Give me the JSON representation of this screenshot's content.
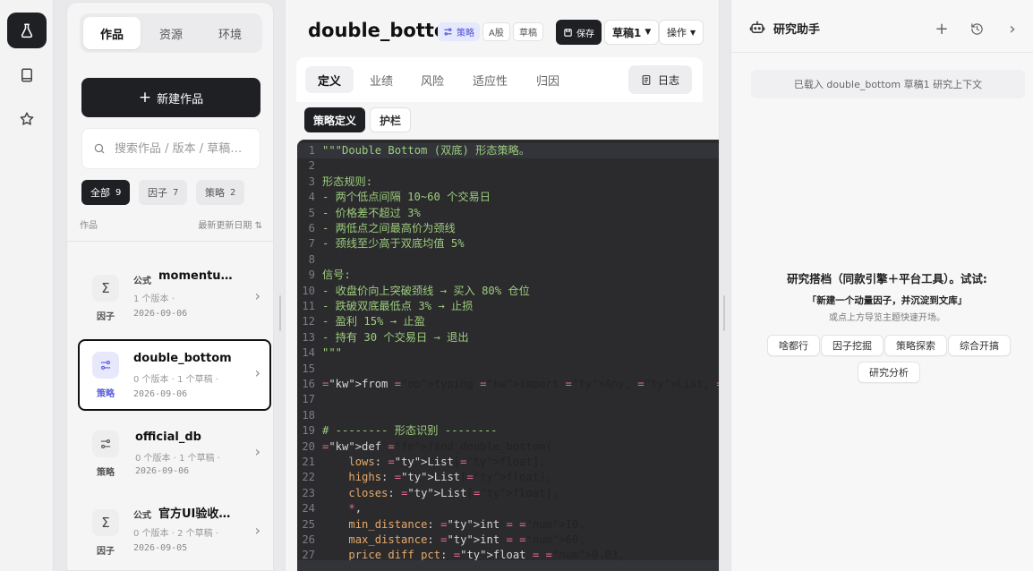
{
  "rail": {
    "items": [
      {
        "icon": "flask-icon",
        "active": true
      },
      {
        "icon": "book-icon",
        "active": false
      },
      {
        "icon": "star-icon",
        "active": false
      }
    ]
  },
  "works_panel": {
    "tabs": [
      "作品",
      "资源",
      "环境"
    ],
    "new_button": "新建作品",
    "search_placeholder": "搜索作品 / 版本 / 草稿…",
    "filters": [
      {
        "label": "全部",
        "count": "9"
      },
      {
        "label": "因子",
        "count": "7"
      },
      {
        "label": "策略",
        "count": "2"
      }
    ],
    "list_header": "作品",
    "sort_label": "最新更新日期",
    "items": [
      {
        "tag": "公式",
        "name": "momentu…",
        "meta": "1 个版本 ·",
        "date": "2026-09-06",
        "type": "因子",
        "kind": "factor"
      },
      {
        "tag": "",
        "name": "double_bottom",
        "meta": "0 个版本 · 1 个草稿 ·",
        "date": "2026-09-06",
        "type": "策略",
        "kind": "strategy"
      },
      {
        "tag": "",
        "name": "official_db",
        "meta": "0 个版本 · 1 个草稿 ·",
        "date": "2026-09-06",
        "type": "策略",
        "kind": "strategy"
      },
      {
        "tag": "公式",
        "name": "官方UI验收…",
        "meta": "0 个版本 · 2 个草稿 ·",
        "date": "2026-09-05",
        "type": "因子",
        "kind": "factor"
      }
    ]
  },
  "editor": {
    "title": "double_bottom",
    "badges": {
      "strategy": "策略",
      "market": "A股",
      "draft": "草稿"
    },
    "save_label": "保存",
    "draft_select": "草稿1",
    "ops_label": "操作",
    "tabs": [
      "定义",
      "业绩",
      "风险",
      "适应性",
      "归因"
    ],
    "log_label": "日志",
    "subtabs": [
      "策略定义",
      "护栏"
    ],
    "code_lines": [
      "\"\"\"Double Bottom (双底) 形态策略。",
      "",
      "形态规则:",
      "- 两个低点间隔 10~60 个交易日",
      "- 价格差不超过 3%",
      "- 两低点之间最高价为颈线",
      "- 颈线至少高于双底均值 5%",
      "",
      "信号:",
      "- 收盘价向上突破颈线 → 买入 80% 仓位",
      "- 跌破双底最低点 3% → 止损",
      "- 盈利 15% → 止盈",
      "- 持有 30 个交易日 → 退出",
      "\"\"\"",
      "",
      "from typing import Any, List, Optional, Tuple",
      "",
      "",
      "# -------- 形态识别 --------",
      "def find_double_bottom(",
      "    lows: List[float],",
      "    highs: List[float],",
      "    closes: List[float],",
      "    *,",
      "    min_distance: int = 10,",
      "    max_distance: int = 60,",
      "    price_diff_pct: float = 0.03,"
    ]
  },
  "assistant": {
    "title": "研究助手",
    "context": "已载入 double_bottom 草稿1 研究上下文",
    "headline": "研究搭档（同款引擎＋平台工具）。试试:",
    "suggestion": "「新建一个动量因子，并沉淀到文库」",
    "hint": "或点上方导览主题快速开场。",
    "quick_actions": [
      "啥都行",
      "因子挖掘",
      "策略探索",
      "综合开搞",
      "研究分析"
    ]
  }
}
